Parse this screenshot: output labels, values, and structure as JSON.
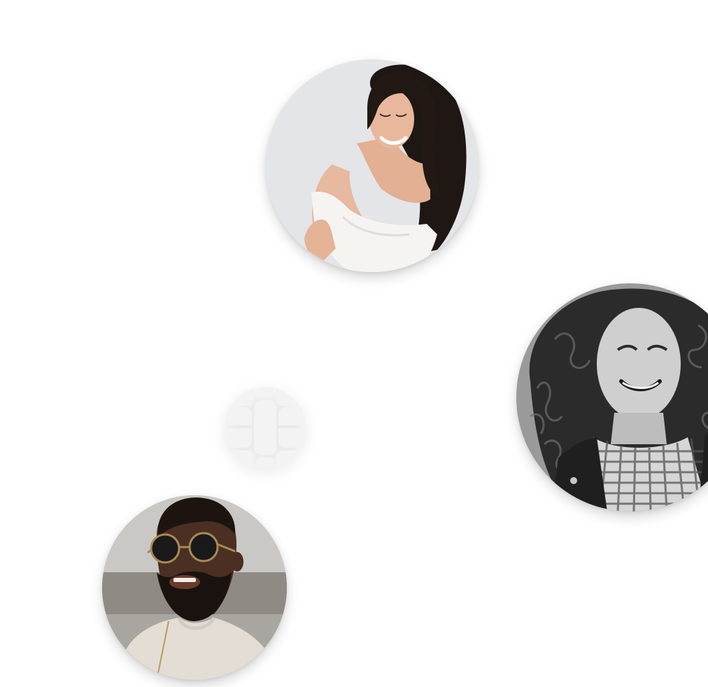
{
  "people": [
    {
      "name_key": "avatar-woman-white-top",
      "icon": "portrait-photo"
    },
    {
      "name_key": "avatar-woman-curly-right",
      "icon": "portrait-photo"
    },
    {
      "name_key": "avatar-man-sunglasses-bottom",
      "icon": "portrait-photo"
    }
  ],
  "center_icon": "app-logo-icon",
  "colors": {
    "background": "#ffffff",
    "logo_fill": "#f3f3f3"
  }
}
